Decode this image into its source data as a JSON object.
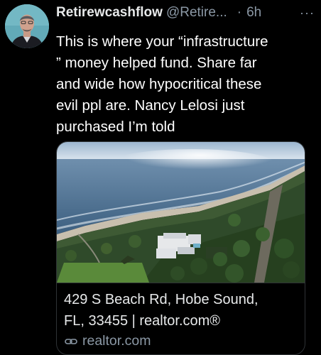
{
  "tweet": {
    "author_name": "Retirewcashflow",
    "author_handle": "@Retire",
    "handle_truncation": "...",
    "separator": "·",
    "time": "6h",
    "more": "···",
    "text_lines": [
      "This is where your “infrastructure",
      "” money helped fund. Share far",
      "and wide how hypocritical these",
      "evil ppl are.  Nancy Lelosi just",
      "purchased I’m told"
    ]
  },
  "card": {
    "title_lines": [
      "429 S Beach Rd, Hobe Sound,",
      "FL, 33455 | realtor.com®"
    ],
    "domain": "realtor.com"
  },
  "icons": {
    "link": "link-icon",
    "more": "more-dots-icon"
  },
  "colors": {
    "background": "#000000",
    "text_primary": "#ffffff",
    "text_secondary": "#8b98a5",
    "border": "#2f3336"
  }
}
